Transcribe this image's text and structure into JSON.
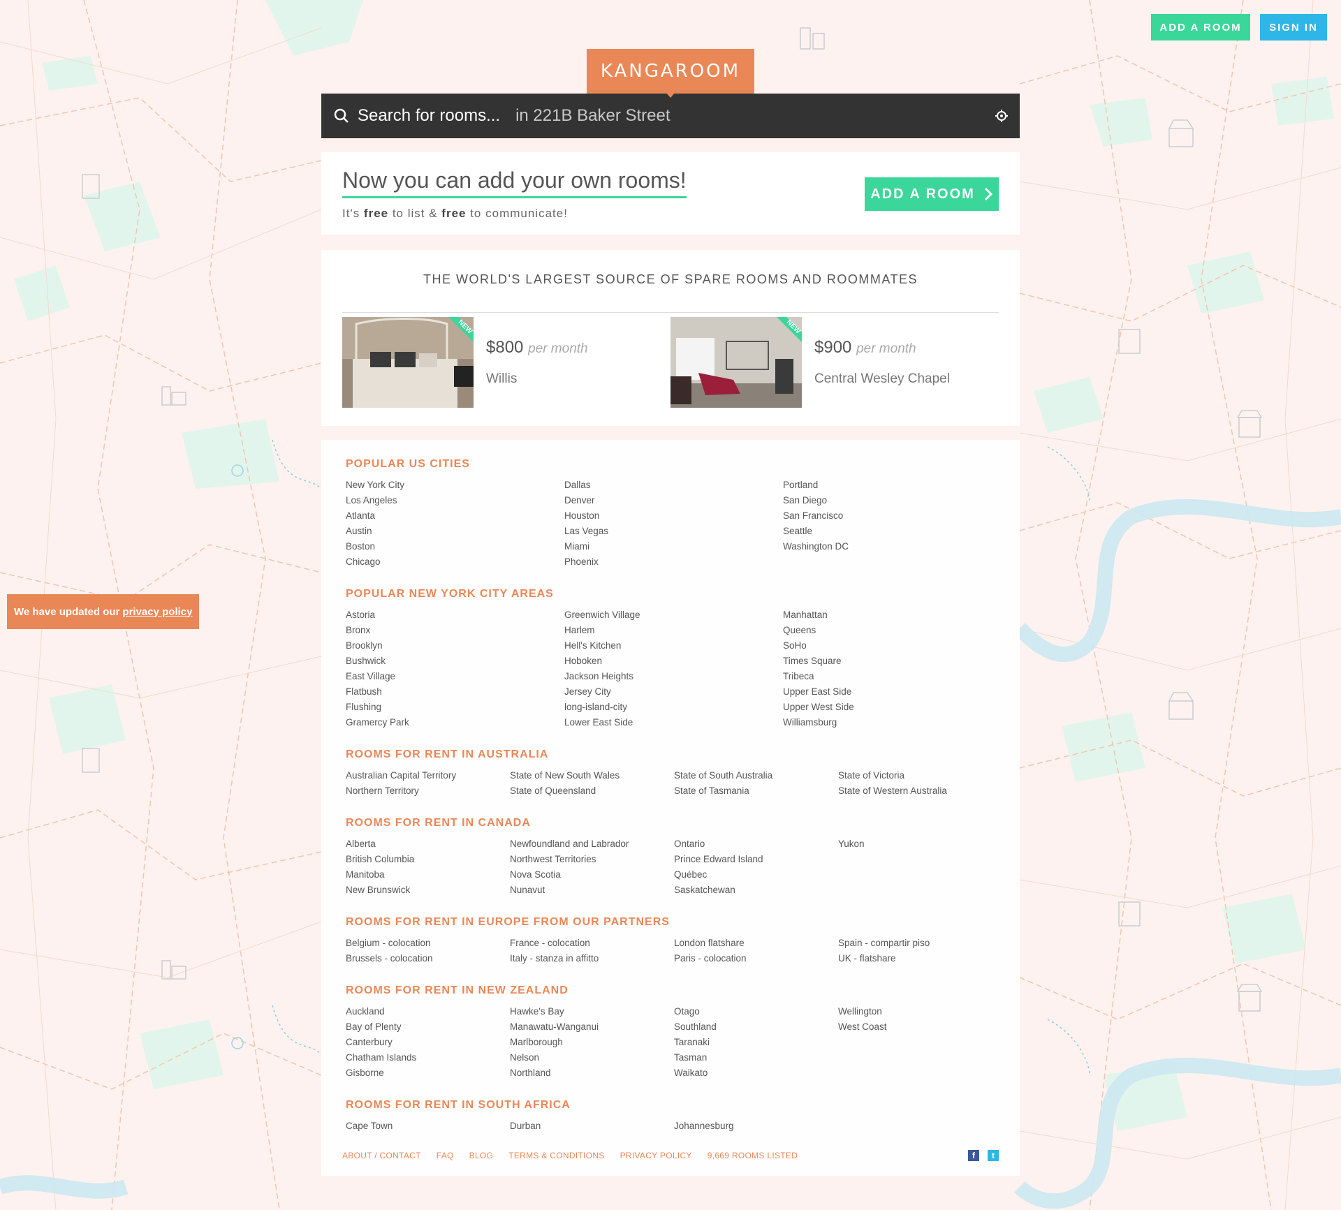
{
  "header": {
    "add_room_label": "ADD A ROOM",
    "sign_in_label": "SIGN IN"
  },
  "logo": "KANGAROOM",
  "search": {
    "placeholder": "Search for rooms...",
    "location": "in 221B Baker Street"
  },
  "add_panel": {
    "title": "Now you can add your own rooms!",
    "subtitle_parts": [
      "It's ",
      "free",
      " to list & ",
      "free",
      " to communicate!"
    ],
    "button_label": "ADD A ROOM"
  },
  "listings": {
    "heading": "THE WORLD'S LARGEST SOURCE OF SPARE ROOMS AND ROOMMATES",
    "items": [
      {
        "price": "$800",
        "unit": "per month",
        "location": "Willis",
        "badge": "NEW"
      },
      {
        "price": "$900",
        "unit": "per month",
        "location": "Central Wesley Chapel",
        "badge": "NEW"
      }
    ]
  },
  "sections": [
    {
      "title": "POPULAR US CITIES",
      "columns": [
        [
          "New York City",
          "Los Angeles",
          "Atlanta",
          "Austin",
          "Boston",
          "Chicago"
        ],
        [
          "Dallas",
          "Denver",
          "Houston",
          "Las Vegas",
          "Miami",
          "Phoenix"
        ],
        [
          "Portland",
          "San Diego",
          "San Francisco",
          "Seattle",
          "Washington DC"
        ]
      ]
    },
    {
      "title": "POPULAR NEW YORK CITY AREAS",
      "columns": [
        [
          "Astoria",
          "Bronx",
          "Brooklyn",
          "Bushwick",
          "East Village",
          "Flatbush",
          "Flushing",
          "Gramercy Park"
        ],
        [
          "Greenwich Village",
          "Harlem",
          "Hell's Kitchen",
          "Hoboken",
          "Jackson Heights",
          "Jersey City",
          "long-island-city",
          "Lower East Side"
        ],
        [
          "Manhattan",
          "Queens",
          "SoHo",
          "Times Square",
          "Tribeca",
          "Upper East Side",
          "Upper West Side",
          "Williamsburg"
        ]
      ]
    },
    {
      "title": "ROOMS FOR RENT IN AUSTRALIA",
      "columns": [
        [
          "Australian Capital Territory",
          "Northern Territory"
        ],
        [
          "State of New South Wales",
          "State of Queensland"
        ],
        [
          "State of South Australia",
          "State of Tasmania"
        ],
        [
          "State of Victoria",
          "State of Western Australia"
        ]
      ]
    },
    {
      "title": "ROOMS FOR RENT IN CANADA",
      "columns": [
        [
          "Alberta",
          "British Columbia",
          "Manitoba",
          "New Brunswick"
        ],
        [
          "Newfoundland and Labrador",
          "Northwest Territories",
          "Nova Scotia",
          "Nunavut"
        ],
        [
          "Ontario",
          "Prince Edward Island",
          "Québec",
          "Saskatchewan"
        ],
        [
          "Yukon"
        ]
      ]
    },
    {
      "title": "ROOMS FOR RENT IN EUROPE FROM OUR PARTNERS",
      "columns": [
        [
          "Belgium - colocation",
          "Brussels - colocation"
        ],
        [
          "France - colocation",
          "Italy - stanza in affitto"
        ],
        [
          "London flatshare",
          "Paris - colocation"
        ],
        [
          "Spain - compartir piso",
          "UK - flatshare"
        ]
      ]
    },
    {
      "title": "ROOMS FOR RENT IN NEW ZEALAND",
      "columns": [
        [
          "Auckland",
          "Bay of Plenty",
          "Canterbury",
          "Chatham Islands",
          "Gisborne"
        ],
        [
          "Hawke's Bay",
          "Manawatu-Wanganui",
          "Marlborough",
          "Nelson",
          "Northland"
        ],
        [
          "Otago",
          "Southland",
          "Taranaki",
          "Tasman",
          "Waikato"
        ],
        [
          "Wellington",
          "West Coast"
        ]
      ]
    },
    {
      "title": "ROOMS FOR RENT IN SOUTH AFRICA",
      "columns": [
        [
          "Cape Town"
        ],
        [
          "Durban"
        ],
        [
          "Johannesburg"
        ]
      ]
    }
  ],
  "footer": {
    "links": [
      "ABOUT / CONTACT",
      "FAQ",
      "BLOG",
      "TERMS & CONDITIONS",
      "PRIVACY POLICY",
      "9,669 ROOMS LISTED"
    ],
    "social": [
      "facebook-icon",
      "twitter-icon"
    ]
  },
  "privacy_notice": {
    "text": "We have updated our",
    "link": "privacy policy"
  },
  "colors": {
    "brand_orange": "#ea8757",
    "accent_green": "#3ad69a",
    "accent_blue": "#2db6e6",
    "search_bg": "#333333"
  }
}
